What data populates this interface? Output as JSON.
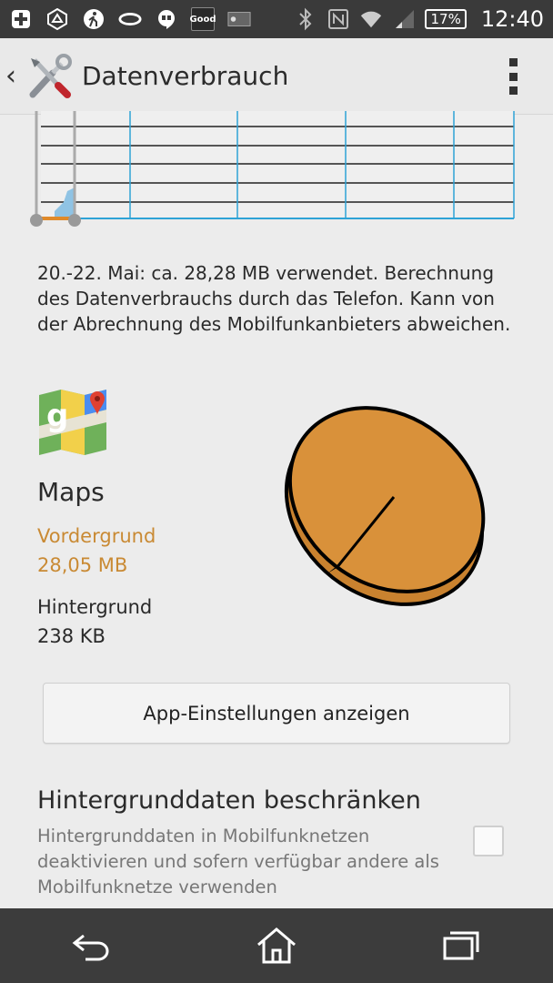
{
  "status_bar": {
    "good_label": "Good",
    "battery": "17%",
    "time": "12:40",
    "icons": [
      "plus-icon",
      "ingress-icon",
      "walker-icon",
      "ring-icon",
      "hangouts-icon",
      "good-icon",
      "card-icon",
      "bluetooth-icon",
      "nfc-icon",
      "wifi-icon",
      "signal-icon",
      "battery-icon"
    ]
  },
  "header": {
    "title": "Datenverbrauch",
    "back_icon": "back-chevron-icon",
    "app_icon": "settings-tools-icon",
    "menu_icon": "overflow-menu-icon"
  },
  "chart_data": {
    "type": "area",
    "x": [],
    "series": [],
    "grid": true,
    "note_visible": "usage cycle chart with start and end handles"
  },
  "usage": {
    "description": "20.-22. Mai: ca. 28,28 MB verwendet. Berechnung des Datenverbrauchs durch das Telefon. Kann von der Abrechnung des Mobilfunkanbieters abweichen."
  },
  "app": {
    "icon": "google-maps-icon",
    "name": "Maps",
    "foreground_label": "Vordergrund",
    "foreground_value": "28,05 MB",
    "background_label": "Hintergrund",
    "background_value": "238 KB",
    "foreground_color": "#c98a34"
  },
  "pie": {
    "foreground_share": 0.992,
    "color": "#d9913a"
  },
  "buttons": {
    "app_settings": "App-Einstellungen anzeigen"
  },
  "restrict": {
    "title": "Hintergrunddaten beschränken",
    "description": "Hintergrunddaten in Mobilfunknetzen deaktivieren und sofern verfügbar andere als Mobilfunknetze verwenden",
    "checked": false
  },
  "navbar": {
    "icons": [
      "back-icon",
      "home-icon",
      "recents-icon"
    ]
  }
}
